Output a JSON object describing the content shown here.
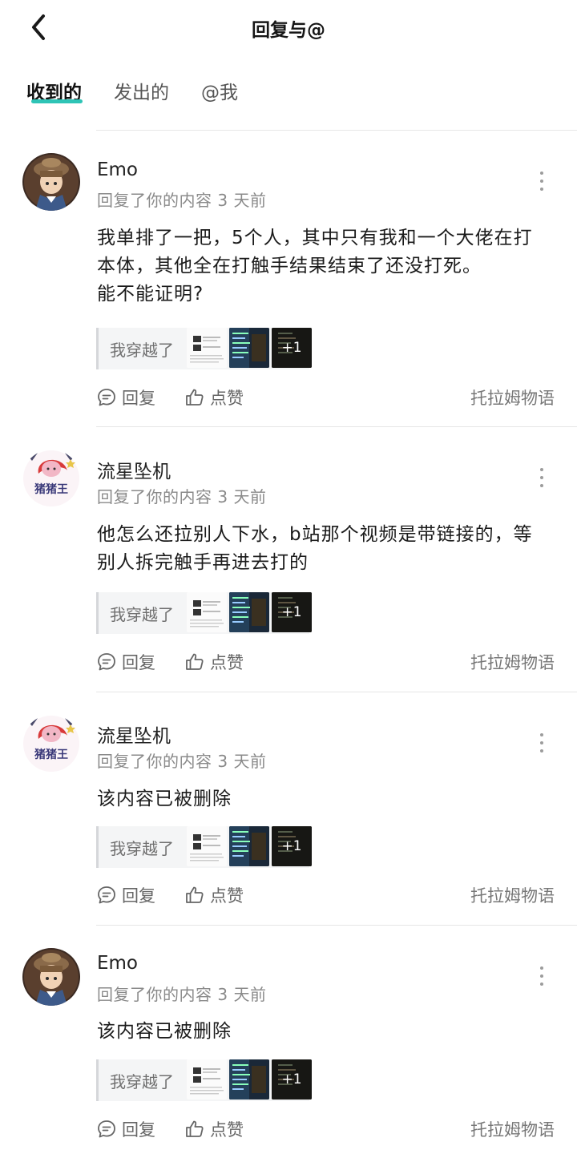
{
  "header": {
    "title": "回复与@",
    "back_icon": "back-chevron-icon"
  },
  "tabs": [
    {
      "label": "收到的",
      "active": true
    },
    {
      "label": "发出的",
      "active": false
    },
    {
      "label": "@我",
      "active": false
    }
  ],
  "accent_color": "#2ec4b6",
  "items": [
    {
      "name": "Emo",
      "meta": "回复了你的内容 3 天前",
      "content_lines": [
        "我单排了一把，5个人，其中只有我和一个大佬在打",
        "本体，其他全在打触手结果结束了还没打死。",
        "能不能证明?"
      ],
      "quote_text": "我穿越了",
      "extra_images": "+1",
      "reply_label": "回复",
      "like_label": "点赞",
      "source": "托拉姆物语"
    },
    {
      "name": "流星坠机",
      "meta": "回复了你的内容 3 天前",
      "avatar_text": "猪猪王",
      "content_lines": [
        "他怎么还拉别人下水，b站那个视频是带链接的，等",
        "别人拆完触手再进去打的"
      ],
      "quote_text": "我穿越了",
      "extra_images": "+1",
      "reply_label": "回复",
      "like_label": "点赞",
      "source": "托拉姆物语"
    },
    {
      "name": "流星坠机",
      "meta": "回复了你的内容 3 天前",
      "avatar_text": "猪猪王",
      "content_lines": [
        "该内容已被删除"
      ],
      "quote_text": "我穿越了",
      "extra_images": "+1",
      "reply_label": "回复",
      "like_label": "点赞",
      "source": "托拉姆物语"
    },
    {
      "name": "Emo",
      "meta": "回复了你的内容 3 天前",
      "content_lines": [
        "该内容已被删除"
      ],
      "quote_text": "我穿越了",
      "extra_images": "+1",
      "reply_label": "回复",
      "like_label": "点赞",
      "source": "托拉姆物语"
    }
  ]
}
